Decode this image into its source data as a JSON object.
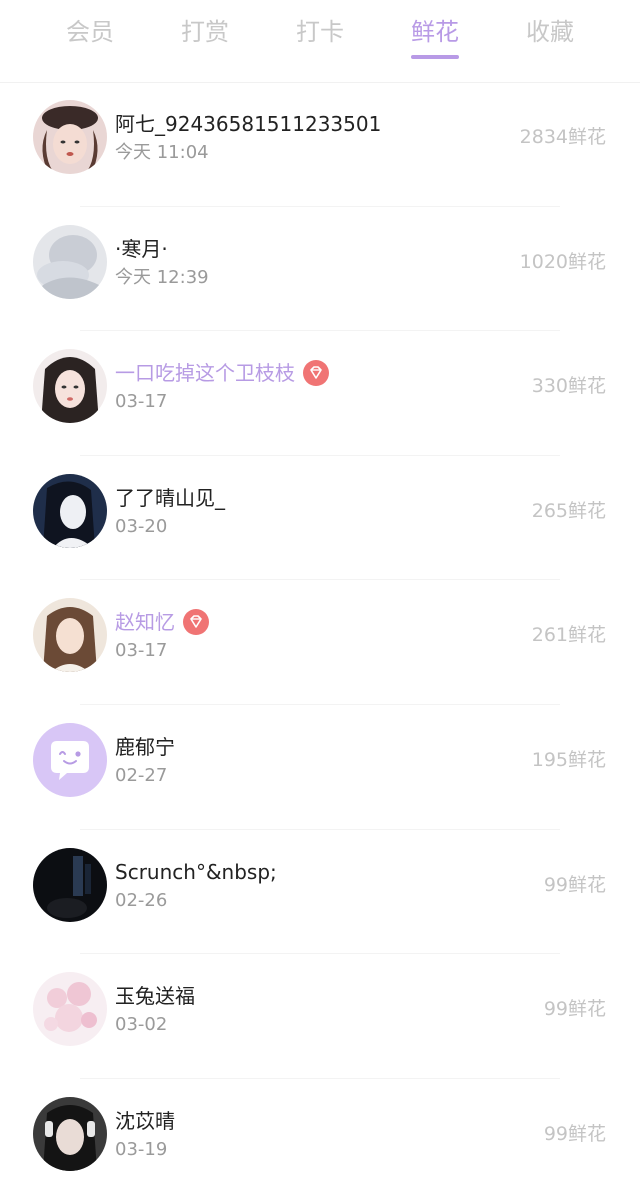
{
  "tabs": [
    {
      "label": "会员"
    },
    {
      "label": "打赏"
    },
    {
      "label": "打卡"
    },
    {
      "label": "鲜花"
    },
    {
      "label": "收藏"
    }
  ],
  "active_tab": "鲜花",
  "colors": {
    "accent": "#b89ae6",
    "vip_badge": "#f07474"
  },
  "rows": [
    {
      "name": "阿七_92436581511233501",
      "date": "今天 11:04",
      "amount": "2834鲜花",
      "vip": false
    },
    {
      "name": "·寒月·",
      "date": "今天 12:39",
      "amount": "1020鲜花",
      "vip": false
    },
    {
      "name": "一口吃掉这个卫枝枝",
      "date": "03-17",
      "amount": "330鲜花",
      "vip": true
    },
    {
      "name": "了了晴山见_",
      "date": "03-20",
      "amount": "265鲜花",
      "vip": false
    },
    {
      "name": "赵知忆",
      "date": "03-17",
      "amount": "261鲜花",
      "vip": true
    },
    {
      "name": "鹿郁宁",
      "date": "02-27",
      "amount": "195鲜花",
      "vip": false
    },
    {
      "name": "Scrunch°&nbsp;",
      "date": "02-26",
      "amount": "99鲜花",
      "vip": false
    },
    {
      "name": "玉兔送福",
      "date": "03-02",
      "amount": "99鲜花",
      "vip": false
    },
    {
      "name": "沈苡晴",
      "date": "03-19",
      "amount": "99鲜花",
      "vip": false
    }
  ]
}
